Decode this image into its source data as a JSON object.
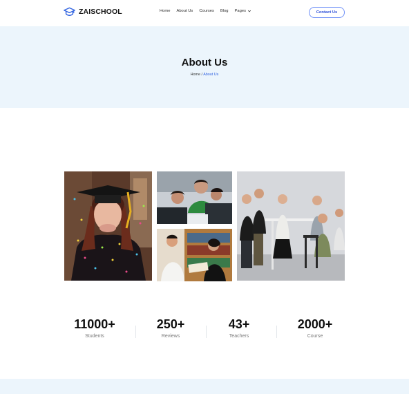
{
  "brand": {
    "name": "ZAISCHOOL",
    "icon": "graduation-cap-icon",
    "accent": "#2f62e0"
  },
  "nav": {
    "items": [
      {
        "label": "Home"
      },
      {
        "label": "About Us"
      },
      {
        "label": "Courses"
      },
      {
        "label": "Blog"
      },
      {
        "label": "Pages",
        "icon": "chevron-down-icon"
      }
    ]
  },
  "contact_button": {
    "label": "Contact Us"
  },
  "hero": {
    "title": "About Us",
    "breadcrumb": {
      "home": "Home",
      "separator": " / ",
      "current": "About Us"
    },
    "background": "#ecf5fc"
  },
  "stats": [
    {
      "value": "11000+",
      "label": "Students"
    },
    {
      "value": "250+",
      "label": "Reviews"
    },
    {
      "value": "43+",
      "label": "Teachers"
    },
    {
      "value": "2000+",
      "label": "Course"
    }
  ]
}
